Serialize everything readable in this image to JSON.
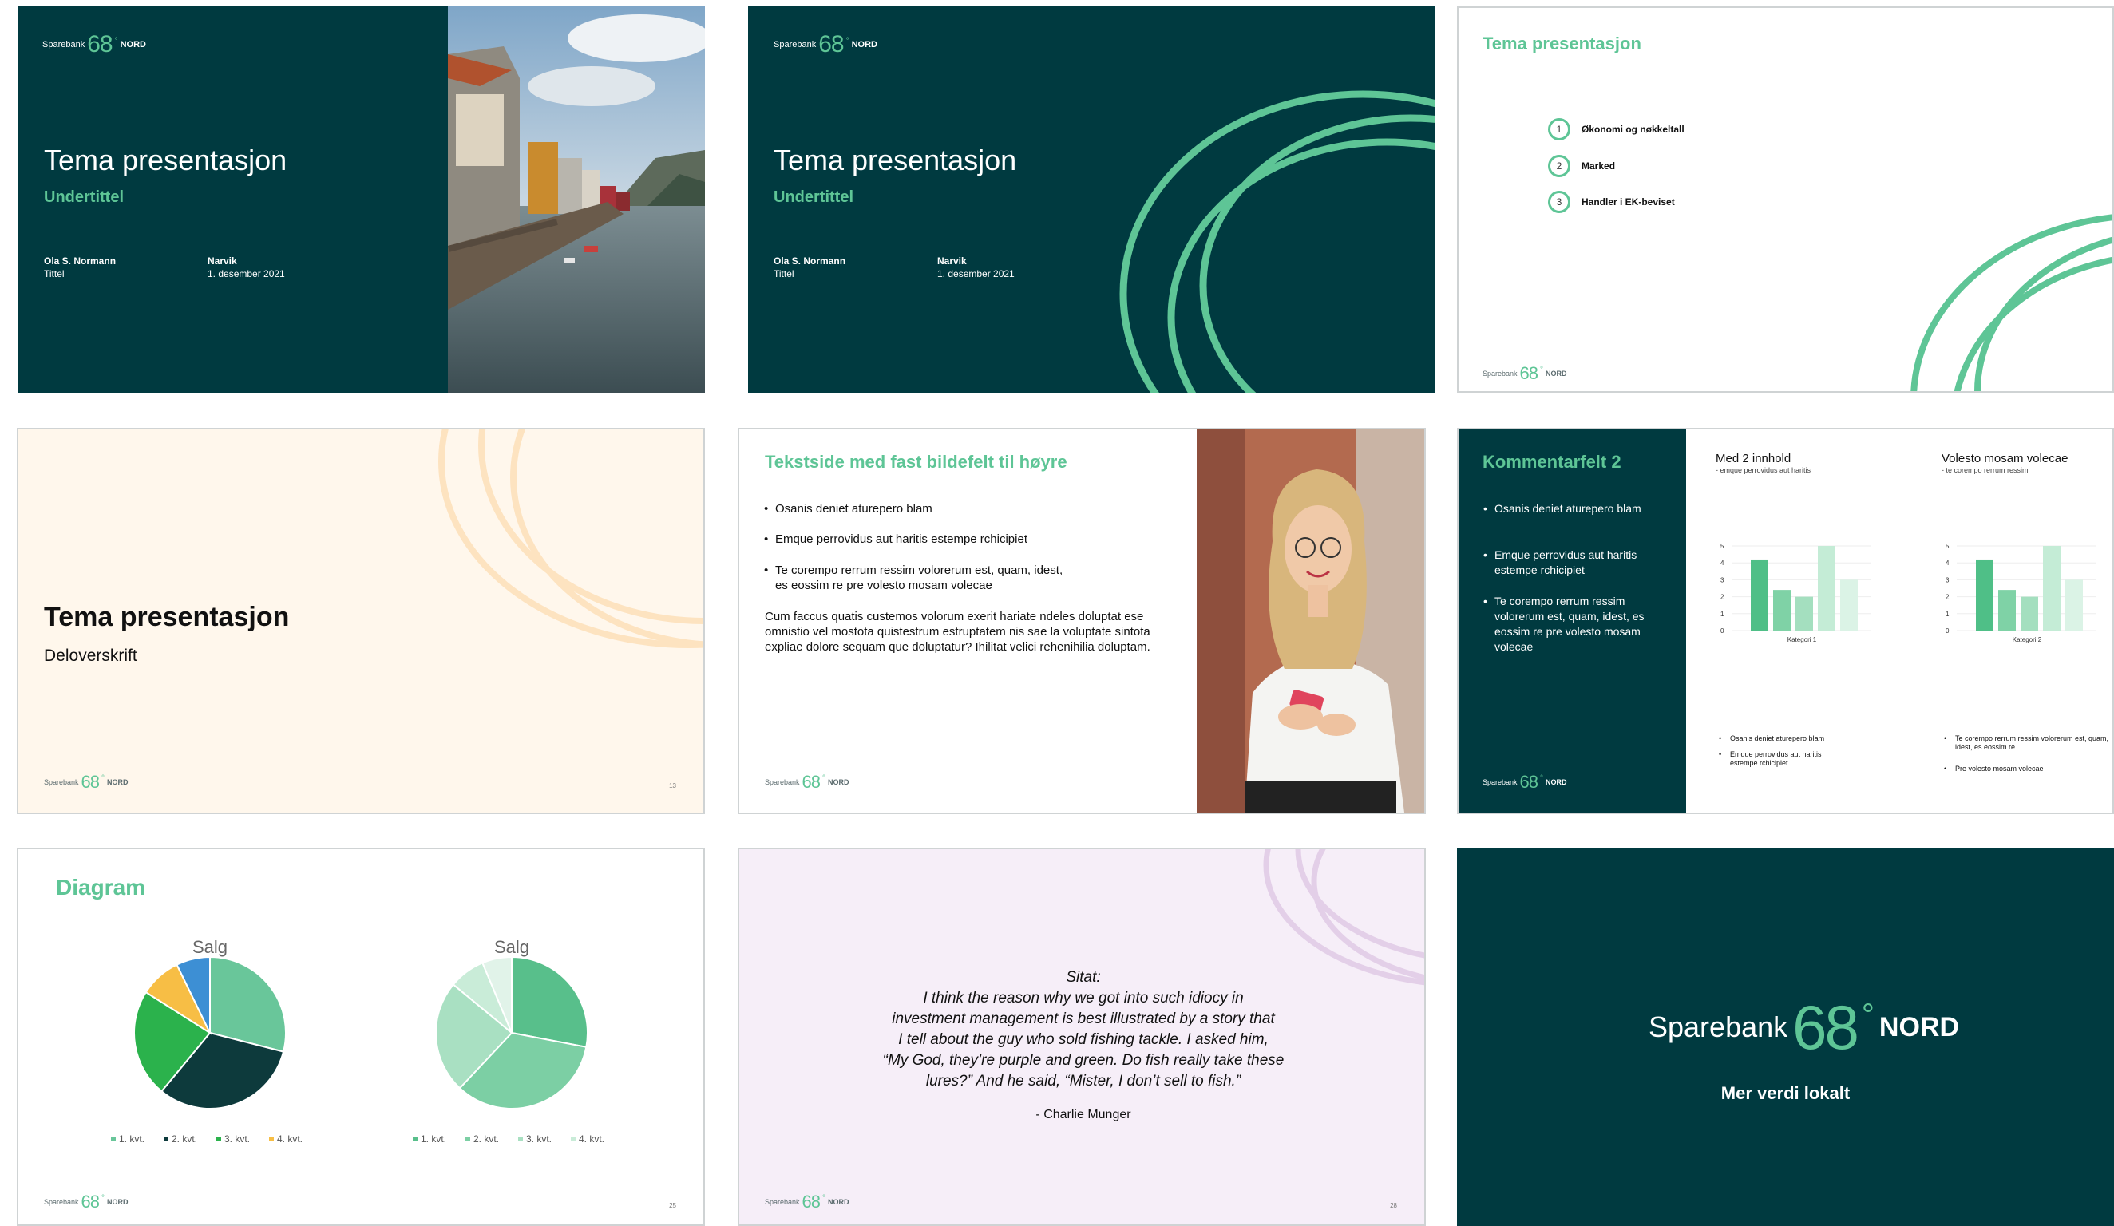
{
  "brand": {
    "bank": "Sparebank",
    "number": "68",
    "degree": "°",
    "region": "NORD"
  },
  "colors": {
    "dark_teal": "#003a40",
    "green": "#5ec596",
    "cream": "#fff7ec",
    "lilac": "#f6eef8"
  },
  "slide1": {
    "title": "Tema presentasjon",
    "subtitle": "Undertittel",
    "name": "Ola S. Normann",
    "role": "Tittel",
    "place": "Narvik",
    "date": "1. desember 2021"
  },
  "slide2": {
    "title": "Tema presentasjon",
    "subtitle": "Undertittel",
    "name": "Ola S. Normann",
    "role": "Tittel",
    "place": "Narvik",
    "date": "1. desember 2021"
  },
  "slide3": {
    "title": "Tema presentasjon",
    "agenda": [
      {
        "num": "1",
        "label": "Økonomi og nøkkeltall"
      },
      {
        "num": "2",
        "label": "Marked"
      },
      {
        "num": "3",
        "label": "Handler i EK-beviset"
      }
    ]
  },
  "slide4": {
    "title": "Tema presentasjon",
    "subtitle": "Deloverskrift",
    "page": "13"
  },
  "slide5": {
    "title": "Tekstside med fast bildefelt til høyre",
    "bullets": [
      "Osanis deniet aturepero blam",
      "Emque perrovidus aut haritis estempe rchicipiet",
      "Te corempo rerrum ressim volorerum est, quam, idest, es eossim re pre volesto mosam volecae"
    ],
    "paragraph": "Cum faccus quatis custemos volorum exerit hariate ndeles doluptat ese omnistio vel mostota quistestrum estruptatem nis sae la voluptate sintota expliae dolore sequam que doluptatur? Ihilitat velici rehenihilia doluptam."
  },
  "slide6": {
    "title": "Kommentarfelt 2",
    "bullets": [
      "Osanis deniet aturepero blam",
      "Emque perrovidus aut haritis estempe rchicipiet",
      "Te corempo rerrum ressim volorerum est, quam, idest, es eossim re pre volesto mosam volecae"
    ],
    "col1_title": "Med 2 innhold",
    "col1_sub": "- emque perrovidus aut haritis",
    "col2_title": "Volesto mosam volecae",
    "col2_sub": "- te corempo rerrum ressim",
    "col1_notes": [
      "Osanis deniet aturepero blam",
      "Emque perrovidus aut haritis estempe rchicipiet"
    ],
    "col2_notes": [
      "Te corempo rerrum ressim volorerum est, quam, idest, es eossim re",
      "Pre volesto mosam volecae"
    ]
  },
  "slide7": {
    "title": "Diagram",
    "page": "25"
  },
  "slide8": {
    "label": "Sitat:",
    "quote_lines": [
      "I think the reason why we got into such idiocy in",
      "investment management is best illustrated by a story that",
      "I tell about the guy who sold fishing tackle. I asked him,",
      "“My God, they’re purple and green. Do fish really take these",
      "lures?” And he said, “Mister, I don’t sell to fish.”"
    ],
    "author": "- Charlie Munger",
    "page": "28"
  },
  "slide9": {
    "tagline": "Mer verdi lokalt"
  },
  "chart_data": [
    {
      "type": "bar",
      "title": "",
      "categories": [
        "Kategori 1"
      ],
      "series": [
        {
          "values": [
            4.2
          ]
        },
        {
          "values": [
            2.4
          ]
        },
        {
          "values": [
            2.0
          ]
        },
        {
          "values": [
            5.0
          ]
        },
        {
          "values": [
            3.0
          ]
        }
      ],
      "ylim": [
        0,
        5
      ],
      "yticks": [
        "0",
        "1",
        "2",
        "3",
        "4",
        "5"
      ],
      "colors": [
        "#4fbf87",
        "#7fd2a6",
        "#a4dfbf",
        "#c4ecd6",
        "#dbf3e6"
      ]
    },
    {
      "type": "bar",
      "title": "",
      "categories": [
        "Kategori 2"
      ],
      "series": [
        {
          "values": [
            4.2
          ]
        },
        {
          "values": [
            2.4
          ]
        },
        {
          "values": [
            2.0
          ]
        },
        {
          "values": [
            5.0
          ]
        },
        {
          "values": [
            3.0
          ]
        }
      ],
      "ylim": [
        0,
        5
      ],
      "yticks": [
        "0",
        "1",
        "2",
        "3",
        "4",
        "5"
      ],
      "colors": [
        "#4fbf87",
        "#7fd2a6",
        "#a4dfbf",
        "#c4ecd6",
        "#dbf3e6"
      ]
    },
    {
      "type": "pie",
      "title": "Salg",
      "categories": [
        "1. kvt.",
        "2. kvt.",
        "3. kvt.",
        "4. kvt."
      ],
      "values": [
        0.29,
        0.32,
        0.23,
        0.16
      ],
      "colors": [
        "#69c69a",
        "#0d3a3c",
        "#2bb24c",
        "#f7be45",
        "#3d8fd4"
      ]
    },
    {
      "type": "pie",
      "title": "Salg",
      "categories": [
        "1. kvt.",
        "2. kvt.",
        "3. kvt.",
        "4. kvt."
      ],
      "values": [
        0.28,
        0.34,
        0.24,
        0.14
      ],
      "colors": [
        "#58bf8b",
        "#7ccfa4",
        "#a9e0c2",
        "#c9ecd8",
        "#e1f3e9"
      ]
    }
  ]
}
